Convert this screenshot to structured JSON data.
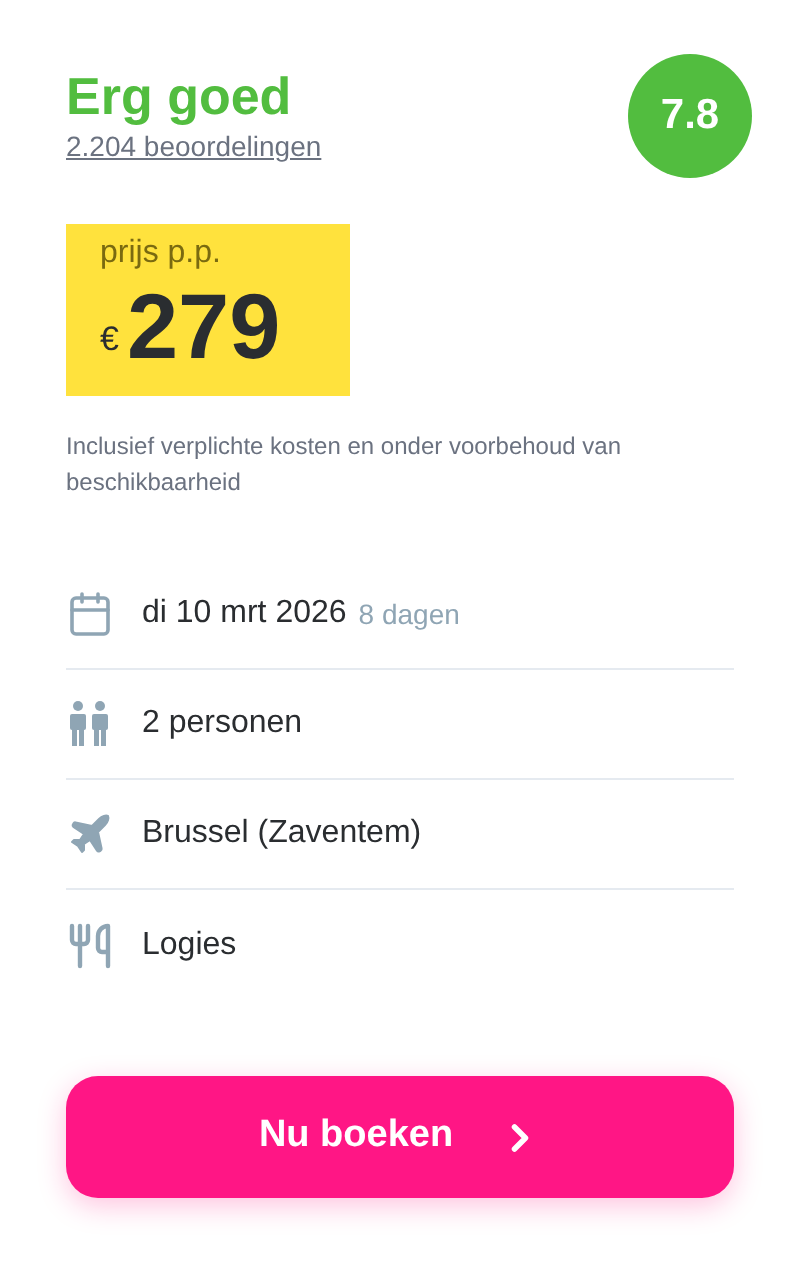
{
  "rating": {
    "label": "Erg goed",
    "reviews": "2.204 beoordelingen",
    "score": "7.8"
  },
  "price": {
    "label": "prijs p.p.",
    "currency": "€",
    "amount": "279"
  },
  "disclaimer": "Inclusief verplichte kosten en onder voorbehoud van beschikbaarheid",
  "details": [
    {
      "kind": "date",
      "text": "di 10 mrt 2026",
      "extra": "8 dagen"
    },
    {
      "kind": "people",
      "text": "2 personen"
    },
    {
      "kind": "flight",
      "text": "Brussel (Zaventem)"
    },
    {
      "kind": "meal",
      "text": "Logies"
    }
  ],
  "book_button": {
    "label": "Nu boeken"
  }
}
